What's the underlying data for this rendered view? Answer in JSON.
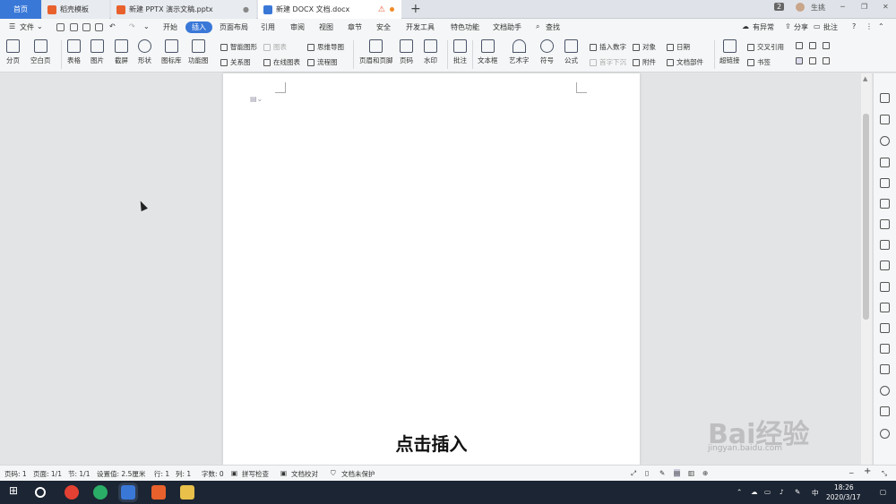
{
  "tabs": [
    {
      "label": "首页"
    },
    {
      "label": "稻壳模板"
    },
    {
      "label": "新建 PPTX 演示文稿.pptx"
    },
    {
      "label": "新建 DOCX 文档.docx"
    }
  ],
  "titlebar": {
    "badge": "2",
    "user": "生挑"
  },
  "menu": {
    "file": "文件",
    "items": [
      "开始",
      "插入",
      "页面布局",
      "引用",
      "审阅",
      "视图",
      "章节",
      "安全",
      "开发工具",
      "特色功能",
      "文档助手"
    ],
    "active": "插入",
    "search": "查找",
    "right": [
      "有异常",
      "分享",
      "批注"
    ]
  },
  "ribbon": {
    "big": [
      "分页",
      "空白页",
      "表格",
      "图片",
      "截屏",
      "形状",
      "图标库",
      "功能图",
      "页眉和页脚",
      "页码",
      "水印",
      "批注",
      "文本框",
      "艺术字",
      "符号",
      "公式",
      "超链接"
    ],
    "small": [
      "智能图形",
      "图表",
      "思维导图",
      "关系图",
      "在线图表",
      "流程图",
      "插入数字",
      "对象",
      "日期",
      "首字下沉",
      "附件",
      "文档部件",
      "交叉引用",
      "书签"
    ]
  },
  "document": {
    "caption": "点击插入"
  },
  "status": {
    "page": "页码: 1",
    "pages": "页面: 1/1",
    "section": "节: 1/1",
    "setting": "设置值: 2.5厘米",
    "row": "行: 1",
    "col": "列: 1",
    "words": "字数: 0",
    "spell": "拼写检查",
    "proof": "文档校对",
    "protect": "文档未保护"
  },
  "taskbar": {
    "ime": "中",
    "time": "18:26",
    "date": "2020/3/17"
  },
  "watermark": {
    "text": "Bai经验",
    "url": "jingyan.baidu.com"
  },
  "colors": {
    "accent": "#3a78d8",
    "pptx": "#e8612c",
    "docx": "#3a78d8",
    "warn": "#e4572e"
  }
}
